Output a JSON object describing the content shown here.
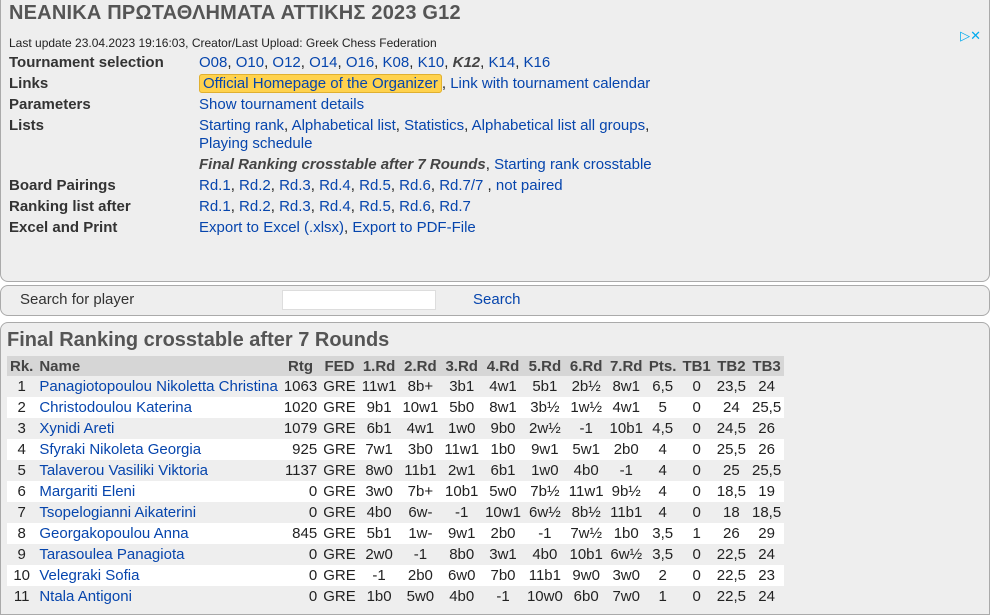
{
  "title": "ΝΕΑΝΙΚΑ ΠΡΩΤΑΘΛΗΜΑΤΑ ΑΤΤΙΚΗΣ 2023 G12",
  "ad_icon": "▷✕",
  "last_update": "Last update 23.04.2023 19:16:03, Creator/Last Upload: Greek Chess Federation",
  "info": {
    "tournament_selection": {
      "label": "Tournament selection",
      "items": [
        "O08",
        "O10",
        "O12",
        "O14",
        "O16",
        "K08",
        "K10",
        "K12",
        "K14",
        "K16"
      ],
      "current": "K12"
    },
    "links": {
      "label": "Links",
      "organizer": "Official Homepage of the Organizer",
      "calendar": "Link with tournament calendar"
    },
    "parameters": {
      "label": "Parameters",
      "details": "Show tournament details"
    },
    "lists": {
      "label": "Lists",
      "starting_rank": "Starting rank",
      "alphabetical": "Alphabetical list",
      "statistics": "Statistics",
      "alpha_all": "Alphabetical list all groups",
      "schedule": "Playing schedule",
      "final_crosstable": "Final Ranking crosstable after 7 Rounds",
      "starting_crosstable": "Starting rank crosstable"
    },
    "board_pairings": {
      "label": "Board Pairings",
      "rounds": [
        "Rd.1",
        "Rd.2",
        "Rd.3",
        "Rd.4",
        "Rd.5",
        "Rd.6",
        "Rd.7/7"
      ],
      "not_paired": "not paired"
    },
    "ranking_after": {
      "label": "Ranking list after",
      "rounds": [
        "Rd.1",
        "Rd.2",
        "Rd.3",
        "Rd.4",
        "Rd.5",
        "Rd.6",
        "Rd.7"
      ]
    },
    "excel_print": {
      "label": "Excel and Print",
      "excel": "Export to Excel (.xlsx)",
      "pdf": "Export to PDF-File"
    }
  },
  "search": {
    "label": "Search for player",
    "button": "Search",
    "value": ""
  },
  "ranking": {
    "title": "Final Ranking crosstable after 7 Rounds",
    "columns": [
      "Rk.",
      "Name",
      "Rtg",
      "FED",
      "1.Rd",
      "2.Rd",
      "3.Rd",
      "4.Rd",
      "5.Rd",
      "6.Rd",
      "7.Rd",
      "Pts.",
      "TB1",
      "TB2",
      "TB3"
    ],
    "rows": [
      [
        "1",
        "Panagiotopoulou Nikoletta Christina",
        "1063",
        "GRE",
        "11w1",
        "8b+",
        "3b1",
        "4w1",
        "5b1",
        "2b½",
        "8w1",
        "6,5",
        "0",
        "23,5",
        "24"
      ],
      [
        "2",
        "Christodoulou Katerina",
        "1020",
        "GRE",
        "9b1",
        "10w1",
        "5b0",
        "8w1",
        "3b½",
        "1w½",
        "4w1",
        "5",
        "0",
        "24",
        "25,5"
      ],
      [
        "3",
        "Xynidi Areti",
        "1079",
        "GRE",
        "6b1",
        "4w1",
        "1w0",
        "9b0",
        "2w½",
        "-1",
        "10b1",
        "4,5",
        "0",
        "24,5",
        "26"
      ],
      [
        "4",
        "Sfyraki Nikoleta Georgia",
        "925",
        "GRE",
        "7w1",
        "3b0",
        "11w1",
        "1b0",
        "9w1",
        "5w1",
        "2b0",
        "4",
        "0",
        "25,5",
        "26"
      ],
      [
        "5",
        "Talaverou Vasiliki Viktoria",
        "1137",
        "GRE",
        "8w0",
        "11b1",
        "2w1",
        "6b1",
        "1w0",
        "4b0",
        "-1",
        "4",
        "0",
        "25",
        "25,5"
      ],
      [
        "6",
        "Margariti Eleni",
        "0",
        "GRE",
        "3w0",
        "7b+",
        "10b1",
        "5w0",
        "7b½",
        "11w1",
        "9b½",
        "4",
        "0",
        "18,5",
        "19"
      ],
      [
        "7",
        "Tsopelogianni Aikaterini",
        "0",
        "GRE",
        "4b0",
        "6w-",
        "-1",
        "10w1",
        "6w½",
        "8b½",
        "11b1",
        "4",
        "0",
        "18",
        "18,5"
      ],
      [
        "8",
        "Georgakopoulou Anna",
        "845",
        "GRE",
        "5b1",
        "1w-",
        "9w1",
        "2b0",
        "-1",
        "7w½",
        "1b0",
        "3,5",
        "1",
        "26",
        "29"
      ],
      [
        "9",
        "Tarasoulea Panagiota",
        "0",
        "GRE",
        "2w0",
        "-1",
        "8b0",
        "3w1",
        "4b0",
        "10b1",
        "6w½",
        "3,5",
        "0",
        "22,5",
        "24"
      ],
      [
        "10",
        "Velegraki Sofia",
        "0",
        "GRE",
        "-1",
        "2b0",
        "6w0",
        "7b0",
        "11b1",
        "9w0",
        "3w0",
        "2",
        "0",
        "22,5",
        "23"
      ],
      [
        "11",
        "Ntala Antigoni",
        "0",
        "GRE",
        "1b0",
        "5w0",
        "4b0",
        "-1",
        "10w0",
        "6b0",
        "7w0",
        "1",
        "0",
        "22,5",
        "24"
      ]
    ]
  }
}
